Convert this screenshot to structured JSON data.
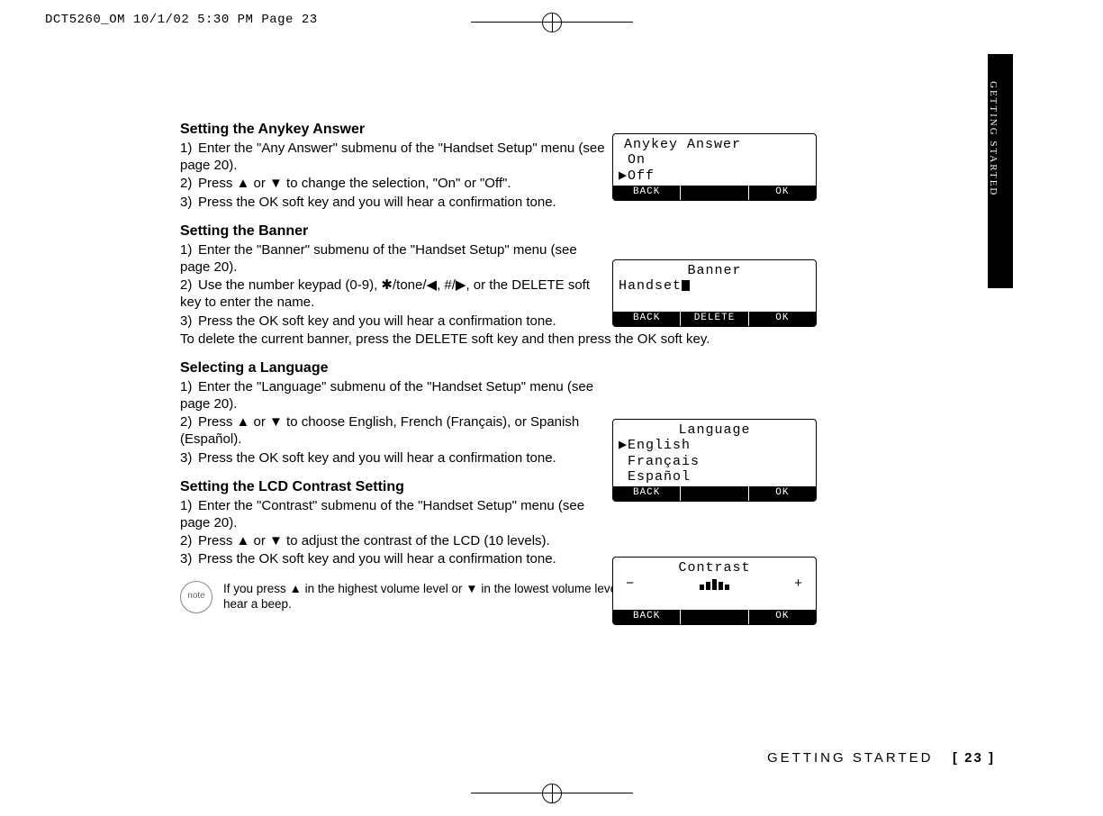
{
  "topline": "DCT5260_OM  10/1/02  5:30 PM  Page 23",
  "side_tab": "GETTING STARTED",
  "footer": {
    "title": "GETTING STARTED",
    "page": "[ 23 ]"
  },
  "anykey": {
    "heading": "Setting the Anykey Answer",
    "steps": [
      "Enter the \"Any Answer\" submenu of the \"Handset Setup\" menu (see page 20).",
      "Press ▲ or ▼ to change the selection, \"On\" or \"Off\".",
      "Press the OK soft key and you will hear a confirmation tone."
    ],
    "lcd": {
      "title": "Anykey Answer",
      "line1": " On",
      "line2": "▶Off",
      "softkeys": [
        "BACK",
        "",
        "OK"
      ]
    }
  },
  "banner": {
    "heading": "Setting the Banner",
    "steps": [
      "Enter the \"Banner\" submenu of the \"Handset Setup\" menu (see page 20).",
      "Use the number keypad (0-9), ✱/tone/◀, #/▶, or the DELETE soft key to enter the name.",
      "Press the OK soft key and you will hear a confirmation tone."
    ],
    "extra": "To delete the current banner, press the DELETE soft key and then press the OK soft key.",
    "lcd": {
      "title": "Banner",
      "line1": "Handset",
      "softkeys": [
        "BACK",
        "DELETE",
        "OK"
      ]
    }
  },
  "language": {
    "heading": "Selecting a Language",
    "steps": [
      "Enter the \"Language\" submenu of the \"Handset Setup\" menu (see page 20).",
      "Press ▲ or ▼ to choose English, French (Français), or Spanish (Español).",
      "Press the OK soft key and you will hear a confirmation tone."
    ],
    "lcd": {
      "title": "Language",
      "line1": "▶English",
      "line2": " Français",
      "line3": " Español",
      "softkeys": [
        "BACK",
        "",
        "OK"
      ]
    }
  },
  "contrast": {
    "heading": "Setting the LCD Contrast Setting",
    "steps": [
      "Enter the \"Contrast\" submenu of the \"Handset Setup\" menu (see page 20).",
      "Press ▲ or ▼ to adjust the contrast of the LCD (10 levels).",
      "Press the OK soft key and you will hear a confirmation tone."
    ],
    "lcd": {
      "title": "Contrast",
      "minus": "−",
      "plus": "+",
      "softkeys": [
        "BACK",
        "",
        "OK"
      ]
    }
  },
  "note": {
    "label": "note",
    "text": "If you press ▲ in the highest volume level or ▼ in the lowest volume level, you will hear a beep."
  }
}
